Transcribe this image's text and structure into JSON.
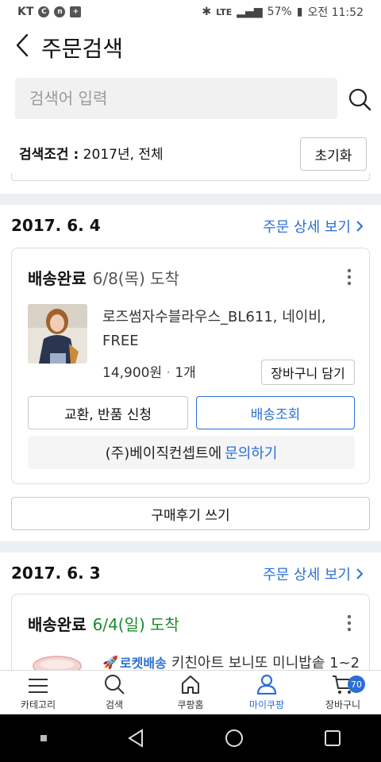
{
  "status_bar": {
    "carrier": "KT",
    "carrier_icons": [
      "c-icon",
      "n-icon",
      "plus-icon"
    ],
    "network": "LTE",
    "battery": "57%",
    "time": "오전 11:52"
  },
  "header": {
    "title": "주문검색",
    "search_placeholder": "검색어 입력",
    "condition_label": "검색조건 :",
    "condition_value": " 2017년, 전체",
    "reset_label": "초기화"
  },
  "orders": [
    {
      "date": "2017. 6. 4",
      "detail_link": "주문 상세 보기",
      "status": "배송완료",
      "arrival": "6/8(목) 도착",
      "product_name": "로즈썸자수블라우스_BL611, 네이비, FREE",
      "price": "14,900원",
      "quantity": "1개",
      "cart_button": "장바구니 담기",
      "return_button": "교환, 반품 신청",
      "track_button": "배송조회",
      "seller": "(주)베이직컨셉트에",
      "inquiry_link": "문의하기",
      "review_button": "구매후기 쓰기"
    },
    {
      "date": "2017. 6. 3",
      "detail_link": "주문 상세 보기",
      "status": "배송완료",
      "arrival": "6/4(일) 도착",
      "badge": "로켓배송",
      "product_name": "키친아트 보니또 미니밥솥 1~2"
    }
  ],
  "bottom_nav": {
    "items": [
      {
        "label": "카테고리",
        "icon": "menu-icon"
      },
      {
        "label": "검색",
        "icon": "search-icon"
      },
      {
        "label": "쿠팡홈",
        "icon": "home-icon"
      },
      {
        "label": "마이쿠팡",
        "icon": "user-icon"
      },
      {
        "label": "장바구니",
        "icon": "cart-icon"
      }
    ],
    "cart_count": "70"
  },
  "colors": {
    "accent": "#2b6fd6",
    "arrival_green": "#1d8a2d"
  }
}
